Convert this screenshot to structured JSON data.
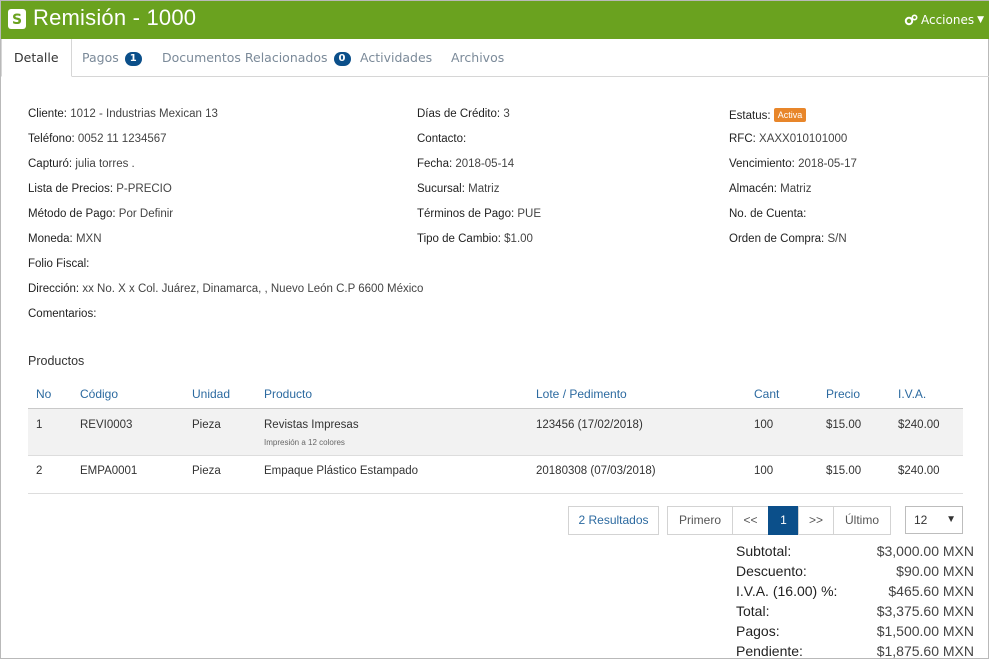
{
  "header": {
    "title": "Remisión - 1000",
    "actions_label": "Acciones",
    "brand_color": "#6aa21f"
  },
  "tabs": [
    {
      "label": "Detalle",
      "badge": null
    },
    {
      "label": "Pagos",
      "badge": "1"
    },
    {
      "label": "Documentos Relacionados",
      "badge": "0"
    },
    {
      "label": "Actividades",
      "badge": null
    },
    {
      "label": "Archivos",
      "badge": null
    }
  ],
  "details": {
    "cliente": {
      "label": "Cliente:",
      "value": "1012 - Industrias Mexican 13"
    },
    "telefono": {
      "label": "Teléfono:",
      "value": "0052 11 1234567"
    },
    "capturo": {
      "label": "Capturó:",
      "value": "julia torres ."
    },
    "lista_precios": {
      "label": "Lista de Precios:",
      "value": "P-PRECIO"
    },
    "metodo_pago": {
      "label": "Método de Pago:",
      "value": "Por Definir"
    },
    "moneda": {
      "label": "Moneda:",
      "value": "MXN"
    },
    "folio_fiscal": {
      "label": "Folio Fiscal:",
      "value": ""
    },
    "direccion": {
      "label": "Dirección:",
      "value": "xx No. X x Col. Juárez, Dinamarca, , Nuevo León C.P 6600 México"
    },
    "comentarios": {
      "label": "Comentarios:",
      "value": ""
    },
    "dias_credito": {
      "label": "Días de Crédito:",
      "value": "3"
    },
    "contacto": {
      "label": "Contacto:",
      "value": ""
    },
    "fecha": {
      "label": "Fecha:",
      "value": "2018-05-14"
    },
    "sucursal": {
      "label": "Sucursal:",
      "value": "Matriz"
    },
    "terminos_pago": {
      "label": "Términos de Pago:",
      "value": "PUE"
    },
    "tipo_cambio": {
      "label": "Tipo de Cambio:",
      "value": "$1.00"
    },
    "estatus": {
      "label": "Estatus:",
      "value": "Activa"
    },
    "rfc": {
      "label": "RFC:",
      "value": "XAXX010101000"
    },
    "vencimiento": {
      "label": "Vencimiento:",
      "value": "2018-05-17"
    },
    "almacen": {
      "label": "Almacén:",
      "value": "Matriz"
    },
    "no_cuenta": {
      "label": "No. de Cuenta:",
      "value": ""
    },
    "orden_compra": {
      "label": "Orden de Compra:",
      "value": "S/N"
    }
  },
  "products": {
    "title": "Productos",
    "columns": [
      "No",
      "Código",
      "Unidad",
      "Producto",
      "Lote / Pedimento",
      "Cant",
      "Precio",
      "I.V.A."
    ],
    "rows": [
      {
        "no": "1",
        "codigo": "REVI0003",
        "unidad": "Pieza",
        "producto": "Revistas Impresas",
        "descripcion": "Impresión a 12 colores",
        "lote": "123456 (17/02/2018)",
        "cant": "100",
        "precio": "$15.00",
        "iva": "$240.00"
      },
      {
        "no": "2",
        "codigo": "EMPA0001",
        "unidad": "Pieza",
        "producto": "Empaque Plástico Estampado",
        "descripcion": "",
        "lote": "20180308 (07/03/2018)",
        "cant": "100",
        "precio": "$15.00",
        "iva": "$240.00"
      }
    ]
  },
  "pagination": {
    "results": "2 Resultados",
    "first": "Primero",
    "prev": "<<",
    "current": "1",
    "next": ">>",
    "last": "Último",
    "page_size": "12"
  },
  "totals": [
    {
      "label": "Subtotal:",
      "value": "$3,000.00 MXN"
    },
    {
      "label": "Descuento:",
      "value": "$90.00 MXN"
    },
    {
      "label": "I.V.A. (16.00) %:",
      "value": "$465.60 MXN"
    },
    {
      "label": "Total:",
      "value": "$3,375.60 MXN"
    },
    {
      "label": "Pagos:",
      "value": "$1,500.00 MXN"
    },
    {
      "label": "Pendiente:",
      "value": "$1,875.60 MXN"
    }
  ]
}
